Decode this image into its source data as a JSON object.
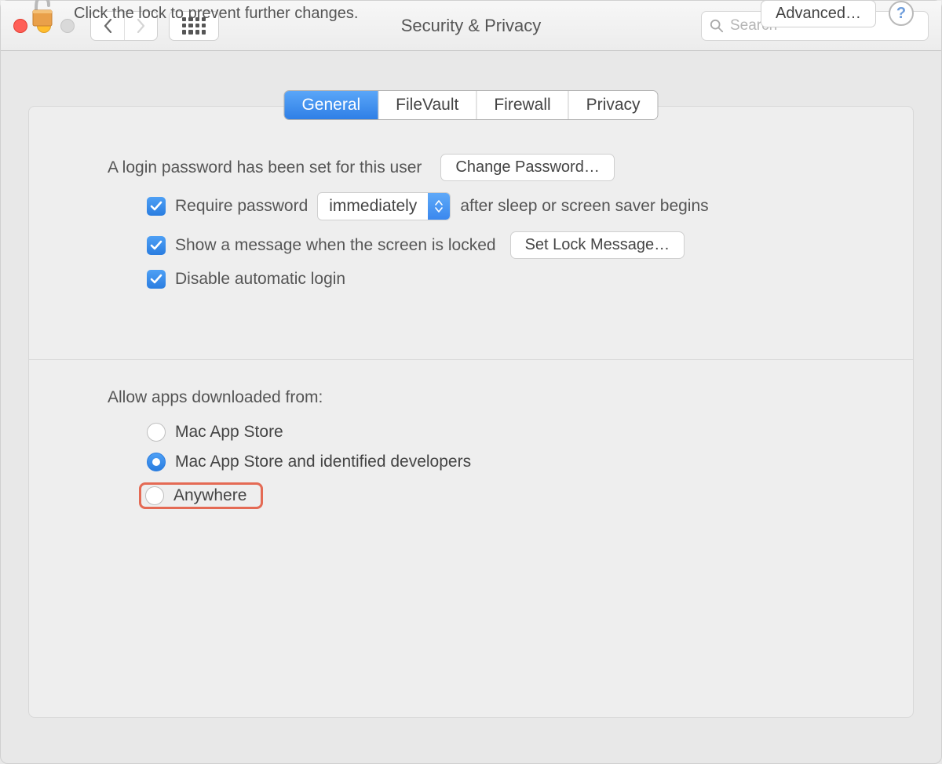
{
  "window": {
    "title": "Security & Privacy"
  },
  "search": {
    "placeholder": "Search"
  },
  "tabs": {
    "general": "General",
    "filevault": "FileVault",
    "firewall": "Firewall",
    "privacy": "Privacy"
  },
  "general": {
    "login_password_text": "A login password has been set for this user",
    "change_password_btn": "Change Password…",
    "require_password_label": "Require password",
    "require_password_select": "immediately",
    "after_sleep_text": "after sleep or screen saver begins",
    "show_message_label": "Show a message when the screen is locked",
    "set_lock_message_btn": "Set Lock Message…",
    "disable_auto_login_label": "Disable automatic login",
    "allow_apps_title": "Allow apps downloaded from:",
    "radio_mac_app_store": "Mac App Store",
    "radio_identified": "Mac App Store and identified developers",
    "radio_anywhere": "Anywhere"
  },
  "footer": {
    "lock_text": "Click the lock to prevent further changes.",
    "advanced_btn": "Advanced…"
  }
}
